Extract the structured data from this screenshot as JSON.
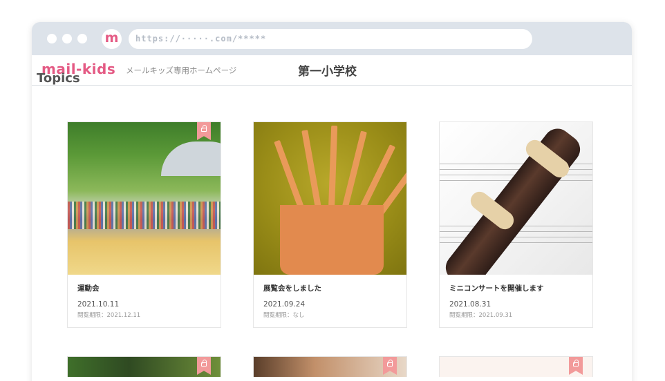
{
  "browser": {
    "favicon_letter": "m",
    "url": "https://·····.com/*****"
  },
  "header": {
    "logo": "mail-kids",
    "tagline": "メールキッズ専用ホームページ",
    "school_name": "第一小学校"
  },
  "topics": {
    "title": "Topics",
    "cards": [
      {
        "title": "運動会",
        "date": "2021.10.11",
        "expiry": "閲覧期限：2021.12.11",
        "image": "sports-day-photo"
      },
      {
        "title": "展覧会をしました",
        "date": "2021.09.24",
        "expiry": "閲覧期限：なし",
        "image": "pencils-photo"
      },
      {
        "title": "ミニコンサートを開催します",
        "date": "2021.08.31",
        "expiry": "閲覧期限：2021.09.31",
        "image": "recorder-photo"
      }
    ]
  },
  "colors": {
    "brand": "#e45a84",
    "bookmark": "#f29a9a",
    "chrome": "#dde3ea"
  },
  "icons": [
    "lock-bookmark-icon"
  ]
}
